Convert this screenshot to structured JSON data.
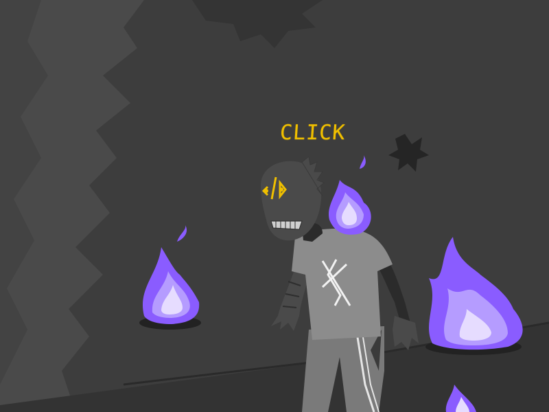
{
  "panel": {
    "sound_effect": "CLICK"
  },
  "colors": {
    "background": "#3c3c3c",
    "wall_shadow": "#2e2e2e",
    "floor": "#333333",
    "sfx_text": "#f0c000",
    "eye_glow": "#f0c000",
    "flame_outer": "#8a5cff",
    "flame_mid": "#b59cff",
    "flame_inner": "#e6dcff",
    "shirt": "#8c8c8c",
    "pants": "#7a7a7a",
    "skin": "#4a4a4a"
  },
  "icons": [
    "purple-flame-icon",
    "rune-symbol-icon",
    "eye-glyph-icon"
  ]
}
